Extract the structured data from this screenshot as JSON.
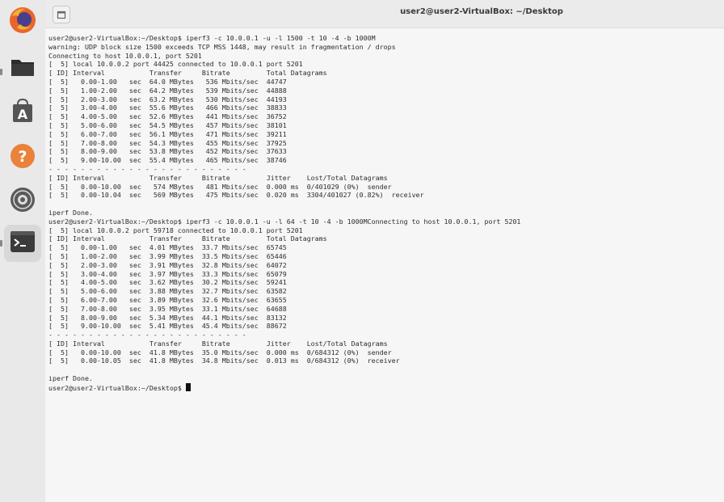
{
  "window": {
    "title": "user2@user2-VirtualBox: ~/Desktop"
  },
  "dock": {
    "items": [
      {
        "name": "Firefox",
        "icon": "firefox-icon"
      },
      {
        "name": "Files",
        "icon": "folder-icon"
      },
      {
        "name": "App Store",
        "icon": "app-store-icon"
      },
      {
        "name": "Help",
        "icon": "help-icon"
      },
      {
        "name": "Disc",
        "icon": "disc-icon"
      },
      {
        "name": "Terminal",
        "icon": "terminal-icon"
      }
    ]
  },
  "terminal": {
    "lines": [
      "user2@user2-VirtualBox:~/Desktop$ iperf3 -c 10.0.0.1 -u -l 1500 -t 10 -4 -b 1000M",
      "warning: UDP block size 1500 exceeds TCP MSS 1448, may result in fragmentation / drops",
      "Connecting to host 10.0.0.1, port 5201",
      "[  5] local 10.0.0.2 port 44425 connected to 10.0.0.1 port 5201",
      "[ ID] Interval           Transfer     Bitrate         Total Datagrams",
      "[  5]   0.00-1.00   sec  64.0 MBytes   536 Mbits/sec  44747",
      "[  5]   1.00-2.00   sec  64.2 MBytes   539 Mbits/sec  44888",
      "[  5]   2.00-3.00   sec  63.2 MBytes   530 Mbits/sec  44193",
      "[  5]   3.00-4.00   sec  55.6 MBytes   466 Mbits/sec  38833",
      "[  5]   4.00-5.00   sec  52.6 MBytes   441 Mbits/sec  36752",
      "[  5]   5.00-6.00   sec  54.5 MBytes   457 Mbits/sec  38101",
      "[  5]   6.00-7.00   sec  56.1 MBytes   471 Mbits/sec  39211",
      "[  5]   7.00-8.00   sec  54.3 MBytes   455 Mbits/sec  37925",
      "[  5]   8.00-9.00   sec  53.8 MBytes   452 Mbits/sec  37633",
      "[  5]   9.00-10.00  sec  55.4 MBytes   465 Mbits/sec  38746",
      "- - - - - - - - - - - - - - - - - - - - - - - - -",
      "[ ID] Interval           Transfer     Bitrate         Jitter    Lost/Total Datagrams",
      "[  5]   0.00-10.00  sec   574 MBytes   481 Mbits/sec  0.000 ms  0/401029 (0%)  sender",
      "[  5]   0.00-10.04  sec   569 MBytes   475 Mbits/sec  0.020 ms  3304/401027 (0.82%)  receiver",
      "",
      "iperf Done.",
      "user2@user2-VirtualBox:~/Desktop$ iperf3 -c 10.0.0.1 -u -l 64 -t 10 -4 -b 1000MConnecting to host 10.0.0.1, port 5201",
      "[  5] local 10.0.0.2 port 59718 connected to 10.0.0.1 port 5201",
      "[ ID] Interval           Transfer     Bitrate         Total Datagrams",
      "[  5]   0.00-1.00   sec  4.01 MBytes  33.7 Mbits/sec  65745",
      "[  5]   1.00-2.00   sec  3.99 MBytes  33.5 Mbits/sec  65446",
      "[  5]   2.00-3.00   sec  3.91 MBytes  32.8 Mbits/sec  64072",
      "[  5]   3.00-4.00   sec  3.97 MBytes  33.3 Mbits/sec  65079",
      "[  5]   4.00-5.00   sec  3.62 MBytes  30.2 Mbits/sec  59241",
      "[  5]   5.00-6.00   sec  3.88 MBytes  32.7 Mbits/sec  63582",
      "[  5]   6.00-7.00   sec  3.89 MBytes  32.6 Mbits/sec  63655",
      "[  5]   7.00-8.00   sec  3.95 MBytes  33.1 Mbits/sec  64688",
      "[  5]   8.00-9.00   sec  5.34 MBytes  44.1 Mbits/sec  83132",
      "[  5]   9.00-10.00  sec  5.41 MBytes  45.4 Mbits/sec  88672",
      "- - - - - - - - - - - - - - - - - - - - - - - - -",
      "[ ID] Interval           Transfer     Bitrate         Jitter    Lost/Total Datagrams",
      "[  5]   0.00-10.00  sec  41.8 MBytes  35.0 Mbits/sec  0.000 ms  0/684312 (0%)  sender",
      "[  5]   0.00-10.05  sec  41.8 MBytes  34.8 Mbits/sec  0.013 ms  0/684312 (0%)  receiver",
      "",
      "iperf Done."
    ],
    "prompt": "user2@user2-VirtualBox:~/Desktop$ "
  },
  "colors": {
    "dock_bg": "#e9e9e9",
    "terminal_bg": "#f6f6f6",
    "text": "#2c2c2c",
    "firefox_orange": "#e8662b",
    "help_orange": "#e9823a",
    "folder": "#2b2b2b"
  }
}
